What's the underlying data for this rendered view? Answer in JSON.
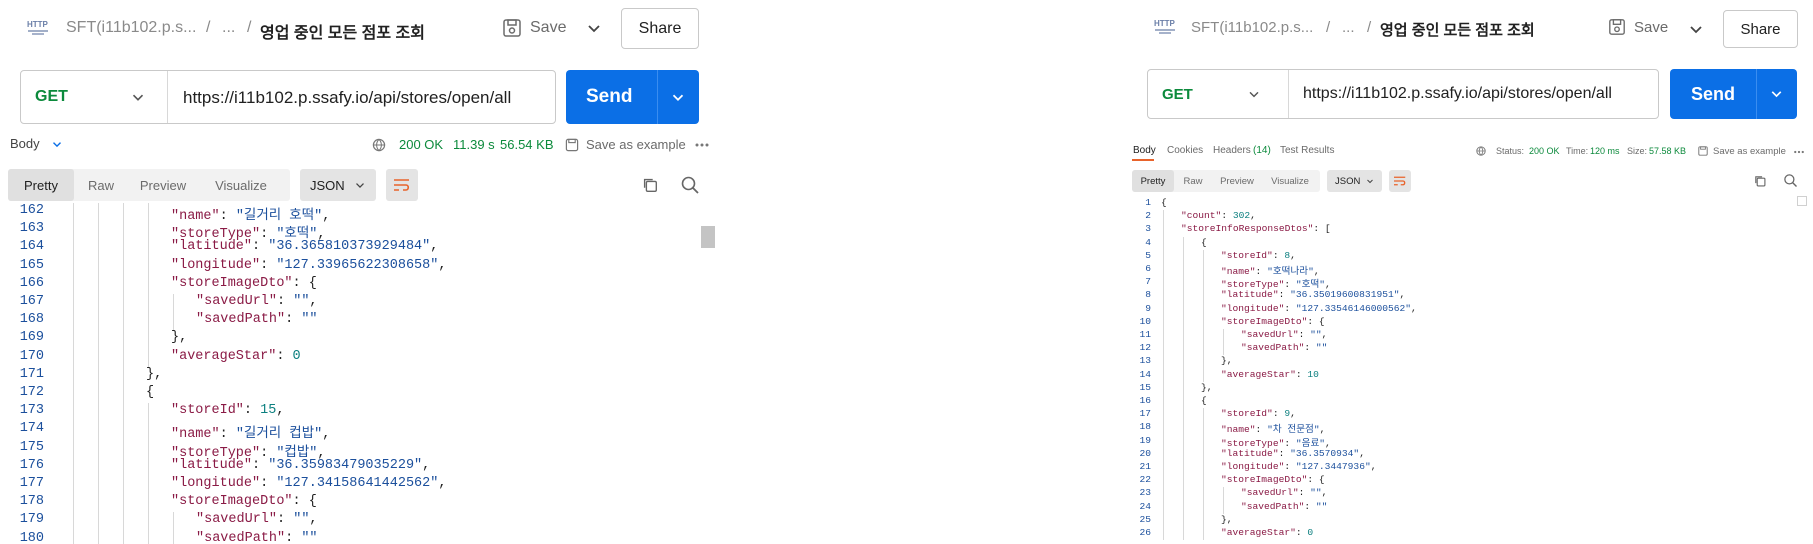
{
  "left": {
    "breadcrumb": {
      "collection": "SFT(i11b102.p.s...",
      "sep1": "/",
      "ellipsis": "...",
      "sep2": "/",
      "title": "영업 중인 모든 점포 조회"
    },
    "save_label": "Save",
    "share_label": "Share",
    "method": "GET",
    "url": "https://i11b102.p.ssafy.io/api/stores/open/all",
    "send_label": "Send",
    "body_label": "Body",
    "status": "200 OK",
    "time": "11.39 s",
    "size": "56.54 KB",
    "save_example": "Save as example",
    "tabs": [
      "Pretty",
      "Raw",
      "Preview",
      "Visualize"
    ],
    "format": "JSON",
    "code_lines": [
      {
        "n": "162",
        "indent": 5,
        "parts": [
          [
            "k",
            "\"name\""
          ],
          [
            "p",
            ": "
          ],
          [
            "s",
            "\"길거리 호떡\""
          ],
          [
            "p",
            ","
          ]
        ]
      },
      {
        "n": "163",
        "indent": 5,
        "parts": [
          [
            "k",
            "\"storeType\""
          ],
          [
            "p",
            ": "
          ],
          [
            "s",
            "\"호떡\""
          ],
          [
            "p",
            ","
          ]
        ]
      },
      {
        "n": "164",
        "indent": 5,
        "parts": [
          [
            "k",
            "\"latitude\""
          ],
          [
            "p",
            ": "
          ],
          [
            "s",
            "\"36.365810373929484\""
          ],
          [
            "p",
            ","
          ]
        ]
      },
      {
        "n": "165",
        "indent": 5,
        "parts": [
          [
            "k",
            "\"longitude\""
          ],
          [
            "p",
            ": "
          ],
          [
            "s",
            "\"127.33965622308658\""
          ],
          [
            "p",
            ","
          ]
        ]
      },
      {
        "n": "166",
        "indent": 5,
        "parts": [
          [
            "k",
            "\"storeImageDto\""
          ],
          [
            "p",
            ": {"
          ]
        ]
      },
      {
        "n": "167",
        "indent": 6,
        "parts": [
          [
            "k",
            "\"savedUrl\""
          ],
          [
            "p",
            ": "
          ],
          [
            "s",
            "\"\""
          ],
          [
            "p",
            ","
          ]
        ]
      },
      {
        "n": "168",
        "indent": 6,
        "parts": [
          [
            "k",
            "\"savedPath\""
          ],
          [
            "p",
            ": "
          ],
          [
            "s",
            "\"\""
          ]
        ]
      },
      {
        "n": "169",
        "indent": 5,
        "parts": [
          [
            "p",
            "},"
          ]
        ]
      },
      {
        "n": "170",
        "indent": 5,
        "parts": [
          [
            "k",
            "\"averageStar\""
          ],
          [
            "p",
            ": "
          ],
          [
            "n",
            "0"
          ]
        ]
      },
      {
        "n": "171",
        "indent": 4,
        "parts": [
          [
            "p",
            "},"
          ]
        ]
      },
      {
        "n": "172",
        "indent": 4,
        "parts": [
          [
            "p",
            "{"
          ]
        ]
      },
      {
        "n": "173",
        "indent": 5,
        "parts": [
          [
            "k",
            "\"storeId\""
          ],
          [
            "p",
            ": "
          ],
          [
            "n",
            "15"
          ],
          [
            "p",
            ","
          ]
        ]
      },
      {
        "n": "174",
        "indent": 5,
        "parts": [
          [
            "k",
            "\"name\""
          ],
          [
            "p",
            ": "
          ],
          [
            "s",
            "\"길거리 컵밥\""
          ],
          [
            "p",
            ","
          ]
        ]
      },
      {
        "n": "175",
        "indent": 5,
        "parts": [
          [
            "k",
            "\"storeType\""
          ],
          [
            "p",
            ": "
          ],
          [
            "s",
            "\"컵밥\""
          ],
          [
            "p",
            ","
          ]
        ]
      },
      {
        "n": "176",
        "indent": 5,
        "parts": [
          [
            "k",
            "\"latitude\""
          ],
          [
            "p",
            ": "
          ],
          [
            "s",
            "\"36.35983479035229\""
          ],
          [
            "p",
            ","
          ]
        ]
      },
      {
        "n": "177",
        "indent": 5,
        "parts": [
          [
            "k",
            "\"longitude\""
          ],
          [
            "p",
            ": "
          ],
          [
            "s",
            "\"127.34158641442562\""
          ],
          [
            "p",
            ","
          ]
        ]
      },
      {
        "n": "178",
        "indent": 5,
        "parts": [
          [
            "k",
            "\"storeImageDto\""
          ],
          [
            "p",
            ": {"
          ]
        ]
      },
      {
        "n": "179",
        "indent": 6,
        "parts": [
          [
            "k",
            "\"savedUrl\""
          ],
          [
            "p",
            ": "
          ],
          [
            "s",
            "\"\""
          ],
          [
            "p",
            ","
          ]
        ]
      },
      {
        "n": "180",
        "indent": 6,
        "parts": [
          [
            "k",
            "\"savedPath\""
          ],
          [
            "p",
            ": "
          ],
          [
            "s",
            "\"\""
          ]
        ]
      }
    ]
  },
  "right": {
    "breadcrumb": {
      "collection": "SFT(i11b102.p.s...",
      "sep1": "/",
      "ellipsis": "...",
      "sep2": "/",
      "title": "영업 중인 모든 점포 조회"
    },
    "save_label": "Save",
    "share_label": "Share",
    "method": "GET",
    "url": "https://i11b102.p.ssafy.io/api/stores/open/all",
    "send_label": "Send",
    "resp_tabs": [
      "Body",
      "Cookies",
      "Headers",
      "Test Results"
    ],
    "headers_count": "(14)",
    "status_label": "Status:",
    "status": "200 OK",
    "time_label": "Time:",
    "time": "120 ms",
    "size_label": "Size:",
    "size": "57.58 KB",
    "save_example": "Save as example",
    "tabs": [
      "Pretty",
      "Raw",
      "Preview",
      "Visualize"
    ],
    "format": "JSON",
    "code_lines": [
      {
        "n": "1",
        "indent": 0,
        "parts": [
          [
            "p",
            "{"
          ]
        ]
      },
      {
        "n": "2",
        "indent": 1,
        "parts": [
          [
            "k",
            "\"count\""
          ],
          [
            "p",
            ": "
          ],
          [
            "n",
            "302"
          ],
          [
            "p",
            ","
          ]
        ]
      },
      {
        "n": "3",
        "indent": 1,
        "parts": [
          [
            "k",
            "\"storeInfoResponseDtos\""
          ],
          [
            "p",
            ": ["
          ]
        ]
      },
      {
        "n": "4",
        "indent": 2,
        "parts": [
          [
            "p",
            "{"
          ]
        ]
      },
      {
        "n": "5",
        "indent": 3,
        "parts": [
          [
            "k",
            "\"storeId\""
          ],
          [
            "p",
            ": "
          ],
          [
            "n",
            "8"
          ],
          [
            "p",
            ","
          ]
        ]
      },
      {
        "n": "6",
        "indent": 3,
        "parts": [
          [
            "k",
            "\"name\""
          ],
          [
            "p",
            ": "
          ],
          [
            "s",
            "\"호떡나라\""
          ],
          [
            "p",
            ","
          ]
        ]
      },
      {
        "n": "7",
        "indent": 3,
        "parts": [
          [
            "k",
            "\"storeType\""
          ],
          [
            "p",
            ": "
          ],
          [
            "s",
            "\"호떡\""
          ],
          [
            "p",
            ","
          ]
        ]
      },
      {
        "n": "8",
        "indent": 3,
        "parts": [
          [
            "k",
            "\"latitude\""
          ],
          [
            "p",
            ": "
          ],
          [
            "s",
            "\"36.35019600831951\""
          ],
          [
            "p",
            ","
          ]
        ]
      },
      {
        "n": "9",
        "indent": 3,
        "parts": [
          [
            "k",
            "\"longitude\""
          ],
          [
            "p",
            ": "
          ],
          [
            "s",
            "\"127.33546146000562\""
          ],
          [
            "p",
            ","
          ]
        ]
      },
      {
        "n": "10",
        "indent": 3,
        "parts": [
          [
            "k",
            "\"storeImageDto\""
          ],
          [
            "p",
            ": {"
          ]
        ]
      },
      {
        "n": "11",
        "indent": 4,
        "parts": [
          [
            "k",
            "\"savedUrl\""
          ],
          [
            "p",
            ": "
          ],
          [
            "s",
            "\"\""
          ],
          [
            "p",
            ","
          ]
        ]
      },
      {
        "n": "12",
        "indent": 4,
        "parts": [
          [
            "k",
            "\"savedPath\""
          ],
          [
            "p",
            ": "
          ],
          [
            "s",
            "\"\""
          ]
        ]
      },
      {
        "n": "13",
        "indent": 3,
        "parts": [
          [
            "p",
            "},"
          ]
        ]
      },
      {
        "n": "14",
        "indent": 3,
        "parts": [
          [
            "k",
            "\"averageStar\""
          ],
          [
            "p",
            ": "
          ],
          [
            "n",
            "10"
          ]
        ]
      },
      {
        "n": "15",
        "indent": 2,
        "parts": [
          [
            "p",
            "},"
          ]
        ]
      },
      {
        "n": "16",
        "indent": 2,
        "parts": [
          [
            "p",
            "{"
          ]
        ]
      },
      {
        "n": "17",
        "indent": 3,
        "parts": [
          [
            "k",
            "\"storeId\""
          ],
          [
            "p",
            ": "
          ],
          [
            "n",
            "9"
          ],
          [
            "p",
            ","
          ]
        ]
      },
      {
        "n": "18",
        "indent": 3,
        "parts": [
          [
            "k",
            "\"name\""
          ],
          [
            "p",
            ": "
          ],
          [
            "s",
            "\"차 전문점\""
          ],
          [
            "p",
            ","
          ]
        ]
      },
      {
        "n": "19",
        "indent": 3,
        "parts": [
          [
            "k",
            "\"storeType\""
          ],
          [
            "p",
            ": "
          ],
          [
            "s",
            "\"음료\""
          ],
          [
            "p",
            ","
          ]
        ]
      },
      {
        "n": "20",
        "indent": 3,
        "parts": [
          [
            "k",
            "\"latitude\""
          ],
          [
            "p",
            ": "
          ],
          [
            "s",
            "\"36.3570934\""
          ],
          [
            "p",
            ","
          ]
        ]
      },
      {
        "n": "21",
        "indent": 3,
        "parts": [
          [
            "k",
            "\"longitude\""
          ],
          [
            "p",
            ": "
          ],
          [
            "s",
            "\"127.3447936\""
          ],
          [
            "p",
            ","
          ]
        ]
      },
      {
        "n": "22",
        "indent": 3,
        "parts": [
          [
            "k",
            "\"storeImageDto\""
          ],
          [
            "p",
            ": {"
          ]
        ]
      },
      {
        "n": "23",
        "indent": 4,
        "parts": [
          [
            "k",
            "\"savedUrl\""
          ],
          [
            "p",
            ": "
          ],
          [
            "s",
            "\"\""
          ],
          [
            "p",
            ","
          ]
        ]
      },
      {
        "n": "24",
        "indent": 4,
        "parts": [
          [
            "k",
            "\"savedPath\""
          ],
          [
            "p",
            ": "
          ],
          [
            "s",
            "\"\""
          ]
        ]
      },
      {
        "n": "25",
        "indent": 3,
        "parts": [
          [
            "p",
            "},"
          ]
        ]
      },
      {
        "n": "26",
        "indent": 3,
        "parts": [
          [
            "k",
            "\"averageStar\""
          ],
          [
            "p",
            ": "
          ],
          [
            "n",
            "0"
          ]
        ]
      }
    ]
  },
  "colors": {
    "send": "#0b6fe6",
    "method": "#0c8a3c",
    "status_ok": "#0c8a3c",
    "accent_tab": "#e8632b"
  }
}
